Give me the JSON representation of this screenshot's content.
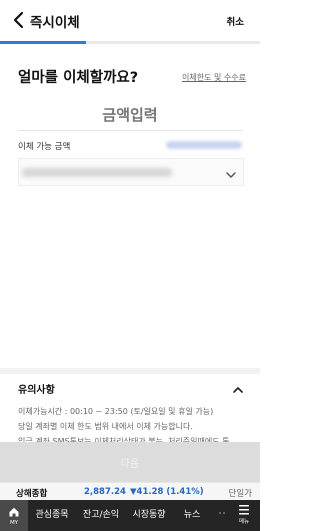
{
  "header": {
    "title": "즉시이체",
    "cancel_label": "취소",
    "progress": 0.33
  },
  "main": {
    "question": "얼마를 이체할까요?",
    "limit_link": "이체한도 및 수수료",
    "amount_placeholder": "금액입력",
    "available_label": "이체 가능 금액"
  },
  "notice": {
    "title": "유의사항",
    "lines": [
      "이체가능시간 : 00:10 ~ 23:50 (토/일요일 및 휴일 가능)",
      "당일 계좌별 이체 한도 범위 내에서 이체 가능합니다.",
      "입금 계좌 SMS통보는 이체처리상태가 불능, 처리중일때에도 통"
    ]
  },
  "next_button_label": "다음",
  "ticker": {
    "name": "상해종합",
    "value": "2,887.24",
    "change": "▼41.28 (1.41%)",
    "unit": "단일가"
  },
  "bottom_nav": {
    "home_label": "MY",
    "items": [
      "관심종목",
      "잔고/손익",
      "시장동향",
      "뉴스"
    ],
    "menu_label": "메뉴"
  },
  "colors": {
    "accent": "#2e7cd6",
    "down": "#2767c4",
    "nav_background": "#252525"
  }
}
